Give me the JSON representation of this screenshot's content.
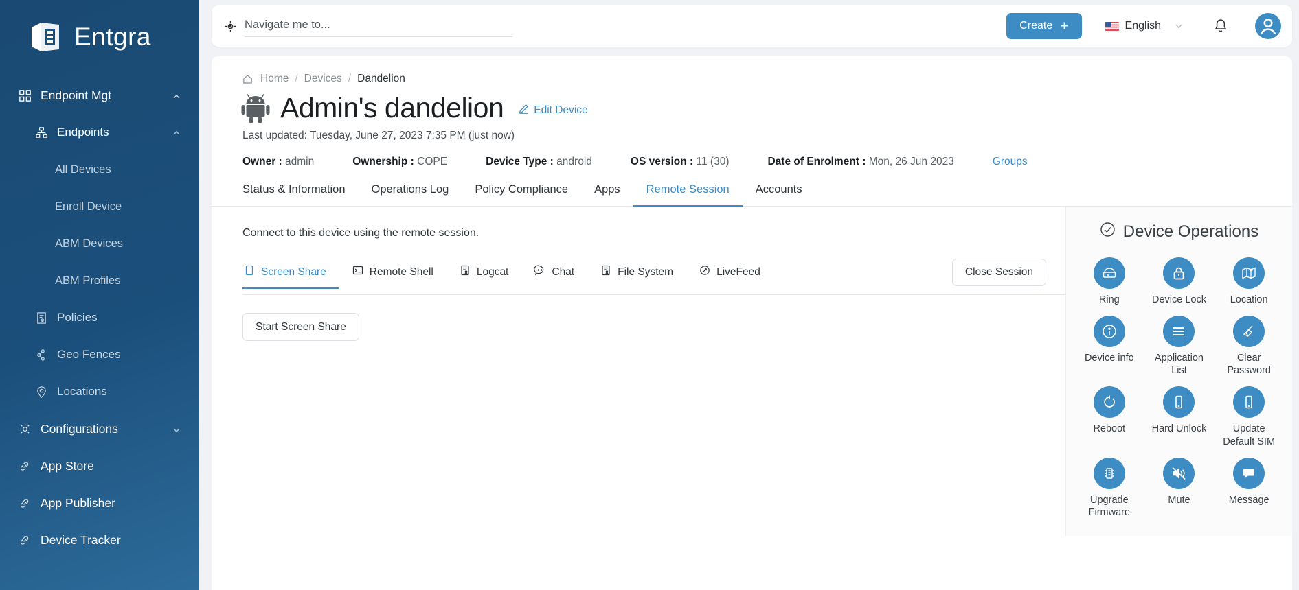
{
  "brand": {
    "name": "Entgra",
    "logo_icon": "entgra-logo-icon",
    "accent": "#3d8cc4",
    "sidebar_bg": "#1b4f7b"
  },
  "sidebar": {
    "items": [
      {
        "label": "Endpoint Mgt",
        "icon": "grid-icon",
        "level": 0,
        "caret": "chevron-up-icon"
      },
      {
        "label": "Endpoints",
        "icon": "sitemap-icon",
        "level": 1,
        "caret": "chevron-up-icon"
      },
      {
        "label": "All Devices",
        "icon": "",
        "level": 2,
        "caret": ""
      },
      {
        "label": "Enroll Device",
        "icon": "",
        "level": 2,
        "caret": ""
      },
      {
        "label": "ABM Devices",
        "icon": "",
        "level": 2,
        "caret": ""
      },
      {
        "label": "ABM Profiles",
        "icon": "",
        "level": 2,
        "caret": ""
      },
      {
        "label": "Policies",
        "icon": "policy-icon",
        "level": 1,
        "caret": ""
      },
      {
        "label": "Geo Fences",
        "icon": "geofence-icon",
        "level": 1,
        "caret": ""
      },
      {
        "label": "Locations",
        "icon": "location-pin-icon",
        "level": 1,
        "caret": ""
      },
      {
        "label": "Configurations",
        "icon": "gear-icon",
        "level": 0,
        "caret": "chevron-down-icon"
      },
      {
        "label": "App Store",
        "icon": "link-icon",
        "level": 0,
        "caret": ""
      },
      {
        "label": "App Publisher",
        "icon": "link-icon",
        "level": 0,
        "caret": ""
      },
      {
        "label": "Device Tracker",
        "icon": "link-icon",
        "level": 0,
        "caret": ""
      }
    ]
  },
  "topbar": {
    "search": {
      "placeholder": "Navigate me to...",
      "value": "",
      "icon": "crosshair-icon"
    },
    "create_label": "Create",
    "create_icon": "plus-icon",
    "language": "English",
    "language_flag": "us-flag-icon",
    "language_caret": "chevron-down-icon",
    "notifications_icon": "bell-icon",
    "profile_icon": "user-avatar-icon"
  },
  "breadcrumb": {
    "home": "Home",
    "items": [
      "Devices"
    ],
    "current": "Dandelion",
    "home_icon": "home-icon",
    "separator": "/"
  },
  "device": {
    "title": "Admin's dandelion",
    "os_icon": "android-robot-icon",
    "edit_label": "Edit Device",
    "edit_icon": "pencil-icon",
    "last_updated": "Last updated: Tuesday, June 27, 2023 7:35 PM (just now)",
    "meta": [
      {
        "label": "Owner :",
        "value": "admin"
      },
      {
        "label": "Ownership :",
        "value": "COPE"
      },
      {
        "label": "Device Type :",
        "value": "android"
      },
      {
        "label": "OS version :",
        "value": "11 (30)"
      },
      {
        "label": "Date of Enrolment :",
        "value": "Mon, 26 Jun 2023"
      }
    ],
    "groups_link": "Groups"
  },
  "tabs": [
    {
      "label": "Status & Information",
      "active": false
    },
    {
      "label": "Operations Log",
      "active": false
    },
    {
      "label": "Policy Compliance",
      "active": false
    },
    {
      "label": "Apps",
      "active": false
    },
    {
      "label": "Remote Session",
      "active": true
    },
    {
      "label": "Accounts",
      "active": false
    }
  ],
  "remote_session": {
    "description": "Connect to this device using the remote session.",
    "close_session_label": "Close Session",
    "start_label": "Start Screen Share",
    "subtabs": [
      {
        "label": "Screen Share",
        "icon": "screen-share-icon",
        "active": true
      },
      {
        "label": "Remote Shell",
        "icon": "terminal-icon",
        "active": false
      },
      {
        "label": "Logcat",
        "icon": "logcat-icon",
        "active": false
      },
      {
        "label": "Chat",
        "icon": "chat-icon",
        "active": false
      },
      {
        "label": "File System",
        "icon": "file-system-icon",
        "active": false
      },
      {
        "label": "LiveFeed",
        "icon": "livefeed-icon",
        "active": false
      }
    ]
  },
  "device_operations": {
    "title": "Device Operations",
    "title_icon": "check-circle-icon",
    "items": [
      {
        "label": "Ring",
        "icon": "ring-phone-icon"
      },
      {
        "label": "Device Lock",
        "icon": "lock-icon"
      },
      {
        "label": "Location",
        "icon": "map-icon"
      },
      {
        "label": "Device info",
        "icon": "info-icon"
      },
      {
        "label": "Application List",
        "icon": "list-icon"
      },
      {
        "label": "Clear Password",
        "icon": "broom-icon"
      },
      {
        "label": "Reboot",
        "icon": "reboot-icon"
      },
      {
        "label": "Hard Unlock",
        "icon": "mobile-icon"
      },
      {
        "label": "Update Default SIM",
        "icon": "mobile-icon"
      },
      {
        "label": "Upgrade Firmware",
        "icon": "chip-icon"
      },
      {
        "label": "Mute",
        "icon": "mute-icon"
      },
      {
        "label": "Message",
        "icon": "message-icon"
      }
    ]
  }
}
